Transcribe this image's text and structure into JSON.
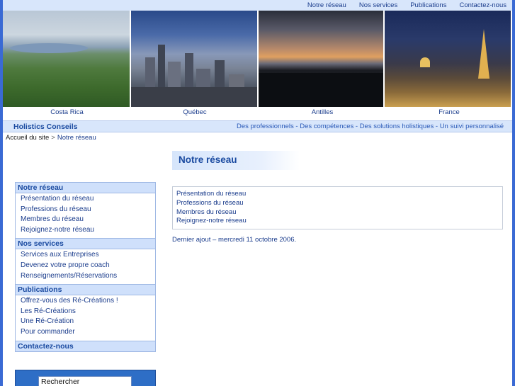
{
  "topnav": [
    "Notre réseau",
    "Nos services",
    "Publications",
    "Contactez-nous"
  ],
  "photos": [
    {
      "caption": "Costa Rica"
    },
    {
      "caption": "Québec"
    },
    {
      "caption": "Antilles"
    },
    {
      "caption": "France"
    }
  ],
  "bar": {
    "brand": "Holistics Conseils",
    "slogan": "Des professionnels - Des compétences - Des solutions holistiques - Un suivi personnalisé"
  },
  "breadcrumb": {
    "home": "Accueil du site",
    "separator": ">",
    "current": "Notre réseau"
  },
  "sidebar": [
    {
      "title": "Notre réseau",
      "items": [
        "Présentation du réseau",
        "Professions du réseau",
        "Membres du réseau",
        "Rejoignez-notre réseau"
      ]
    },
    {
      "title": "Nos services",
      "items": [
        "Services aux Entreprises",
        "Devenez votre propre coach",
        "Renseignements/Réservations"
      ]
    },
    {
      "title": "Publications",
      "items": [
        "Offrez-vous des Ré-Créations !",
        "Les Ré-Créations",
        "Une Ré-Création",
        "Pour commander"
      ]
    },
    {
      "title": "Contactez-nous",
      "items": []
    }
  ],
  "search": {
    "value": "Rechercher"
  },
  "main": {
    "title": "Notre réseau",
    "links": [
      "Présentation du réseau",
      "Professions du réseau",
      "Membres du réseau",
      "Rejoignez-notre réseau"
    ],
    "updated": "Dernier ajout – mercredi 11 octobre 2006."
  },
  "colors": {
    "accent": "#1a4aa0",
    "frame": "#3a6ad4",
    "bar_bg": "#d8e6fb",
    "search_bg": "#2e6ec6"
  }
}
